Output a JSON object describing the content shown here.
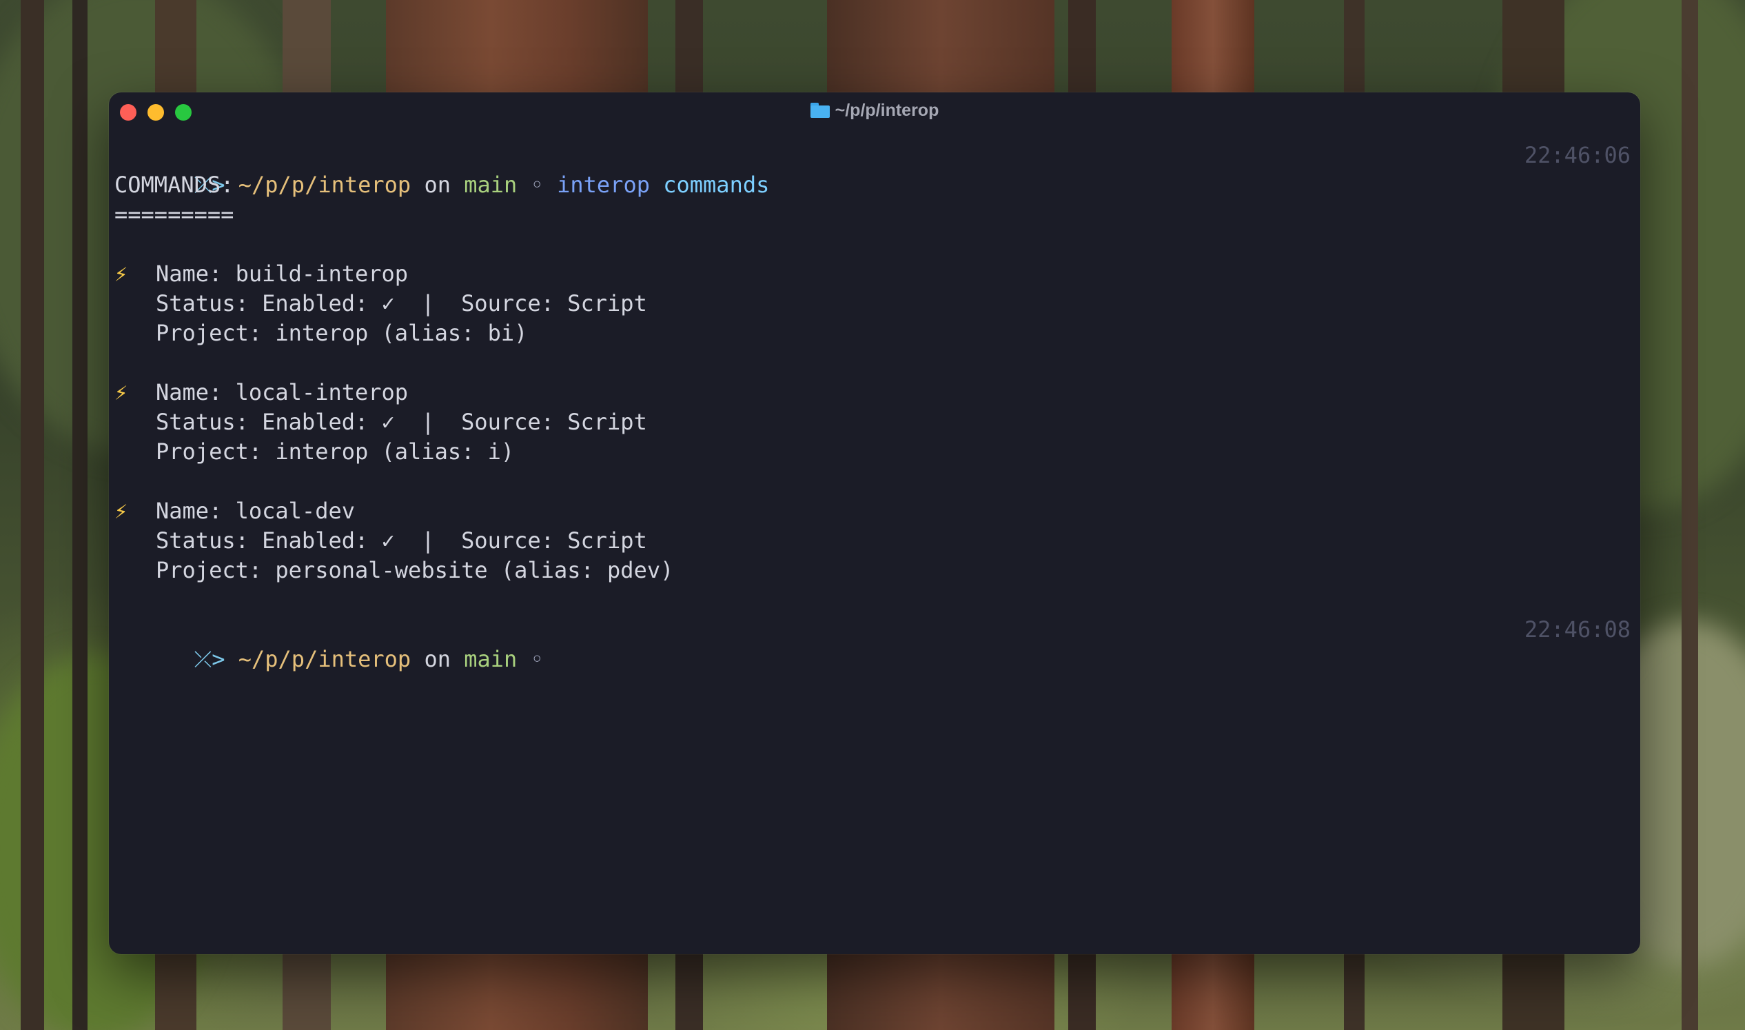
{
  "window": {
    "title": "~/p/p/interop",
    "icon": "folder-icon"
  },
  "prompt1": {
    "symbol": "⤫>",
    "path": "~/p/p/interop",
    "on": "on",
    "branch": "main",
    "dot": "◦",
    "command": "interop",
    "argument": "commands",
    "time": "22:46:06"
  },
  "output": {
    "header": "COMMANDS:",
    "underline": "=========",
    "bullet": "⚡",
    "commands": [
      {
        "name_line": "Name: build-interop",
        "status_line": "Status: Enabled: ✓  |  Source: Script",
        "project_line": "Project: interop (alias: bi)"
      },
      {
        "name_line": "Name: local-interop",
        "status_line": "Status: Enabled: ✓  |  Source: Script",
        "project_line": "Project: interop (alias: i)"
      },
      {
        "name_line": "Name: local-dev",
        "status_line": "Status: Enabled: ✓  |  Source: Script",
        "project_line": "Project: personal-website (alias: pdev)"
      }
    ]
  },
  "prompt2": {
    "symbol": "⤫>",
    "path": "~/p/p/interop",
    "on": "on",
    "branch": "main",
    "dot": "◦",
    "time": "22:46:08"
  },
  "colors": {
    "terminal_bg": "#1b1c27",
    "path": "#e6c07b",
    "branch": "#a9d17e",
    "command": "#7aa2f7",
    "argument": "#7dcfff",
    "bolt": "#f7c948",
    "timestamp": "#4f5266"
  }
}
